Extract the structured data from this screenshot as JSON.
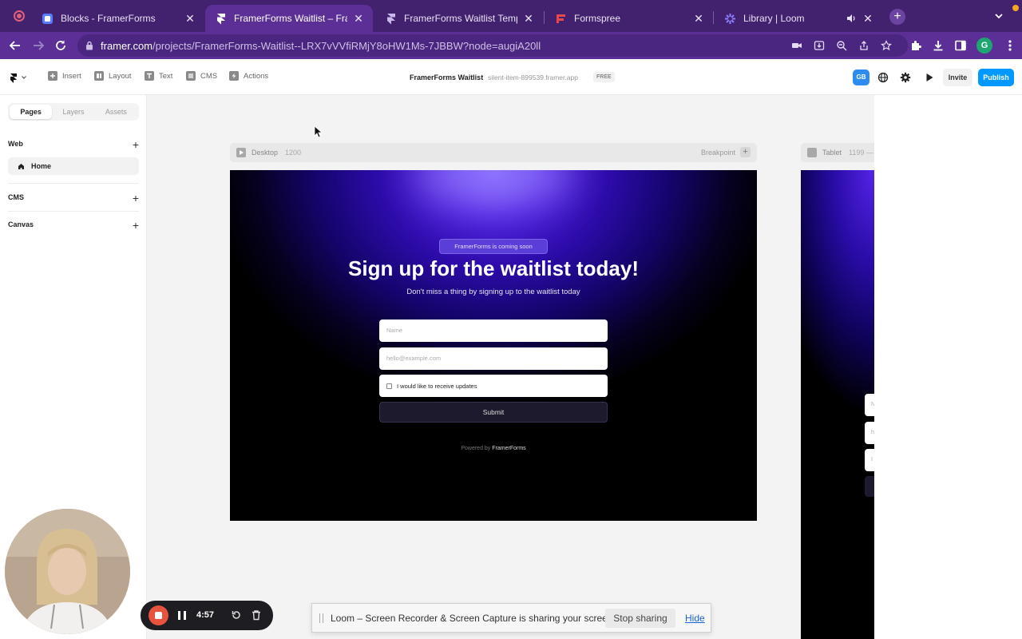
{
  "browser": {
    "tabs": [
      {
        "title": "Blocks - FramerForms",
        "icon": "framerforms-blocks-icon",
        "active": false
      },
      {
        "title": "FramerForms Waitlist – Fra",
        "icon": "framer-icon",
        "active": true
      },
      {
        "title": "FramerForms Waitlist Templat",
        "icon": "framer-icon",
        "active": false
      },
      {
        "title": "Formspree",
        "icon": "formspree-icon",
        "active": false
      },
      {
        "title": "Library | Loom",
        "icon": "loom-icon",
        "active": false
      }
    ],
    "url_host": "framer.com",
    "url_path": "/projects/FramerForms-Waitlist--LRX7vVVfiRMjY8oHW1Ms-7JBBW?node=augiA20ll",
    "profile_initial": "G",
    "colors": {
      "tab_strip": "#42216e",
      "active_tab": "#5b2f95",
      "accent": "#0099ff"
    }
  },
  "toolbar": {
    "tools": [
      "Insert",
      "Layout",
      "Text",
      "CMS",
      "Actions"
    ],
    "project_title": "FramerForms Waitlist",
    "project_domain": "silent-item-899539.framer.app",
    "plan_badge": "FREE",
    "user_badge": "GB",
    "invite_label": "Invite",
    "publish_label": "Publish"
  },
  "left_panel": {
    "tabs": [
      "Pages",
      "Layers",
      "Assets"
    ],
    "active_tab": "Pages",
    "sections": {
      "web": "Web",
      "cms": "CMS",
      "canvas": "Canvas"
    },
    "pages": [
      "Home"
    ]
  },
  "canvas": {
    "desktop_breakpoint": {
      "label": "Desktop",
      "width": "1200",
      "breakpoint_label": "Breakpoint"
    },
    "tablet_breakpoint": {
      "label": "Tablet",
      "width": "1199 —"
    },
    "site": {
      "badge": "FramerForms is coming soon",
      "headline": "Sign up for the waitlist today!",
      "subheadline": "Don't miss a thing by signing up to the waitlist today",
      "name_placeholder": "Name",
      "email_placeholder": "hello@example.com",
      "checkbox_label": "I would like to receive updates",
      "submit_label": "Submit",
      "powered_prefix": "Powered by",
      "powered_brand": "FramerForms",
      "colors": {
        "glow": "#7a55ff",
        "deep": "#2c0ba8",
        "background": "#000000"
      }
    },
    "tablet_field_letters": [
      "N",
      "h",
      "I"
    ]
  },
  "loom": {
    "timer": "4:57",
    "share_message": "Loom – Screen Recorder & Screen Capture is sharing your screen.",
    "stop_sharing_label": "Stop sharing",
    "hide_label": "Hide"
  }
}
